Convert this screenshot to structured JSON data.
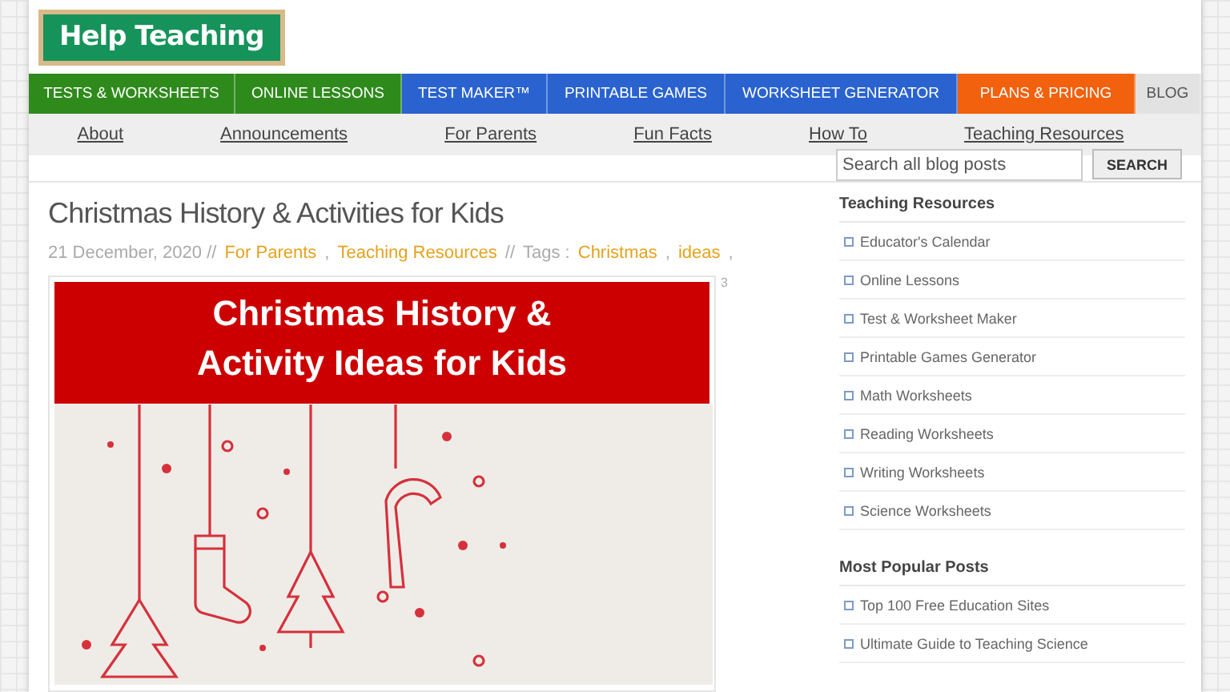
{
  "logo": {
    "text": "Help Teaching"
  },
  "nav": [
    {
      "label": "TESTS & WORKSHEETS",
      "color": "#2f8a1c",
      "selected": false
    },
    {
      "label": "ONLINE LESSONS",
      "color": "#2f8a1c",
      "selected": false
    },
    {
      "label": "TEST MAKER™",
      "color": "#2a63cf",
      "selected": false
    },
    {
      "label": "PRINTABLE GAMES",
      "color": "#2a63cf",
      "selected": false
    },
    {
      "label": "WORKSHEET GENERATOR",
      "color": "#2a63cf",
      "selected": false
    },
    {
      "label": "PLANS & PRICING",
      "color": "#f2610d",
      "selected": false
    },
    {
      "label": "BLOG",
      "color": "#e2e2e2",
      "selected": true
    }
  ],
  "subnav": [
    "About",
    "Announcements",
    "For Parents",
    "Fun Facts",
    "How To",
    "Teaching Resources"
  ],
  "search": {
    "placeholder": "Search all blog posts",
    "button": "SEARCH"
  },
  "post": {
    "title": "Christmas History & Activities for Kids",
    "date": "21 December, 2020 //",
    "categories": [
      "For Parents",
      "Teaching Resources"
    ],
    "list_separator": ",",
    "tags_separator": "//",
    "tags_label": "Tags :",
    "tags": [
      "Christmas",
      "ideas"
    ],
    "image": {
      "banner": "Christmas History & Activity Ideas for Kids",
      "corner_mark": "3"
    }
  },
  "sidebar": [
    {
      "heading": "Teaching Resources",
      "items": [
        "Educator's Calendar",
        "Online Lessons",
        "Test & Worksheet Maker",
        "Printable Games Generator",
        "Math Worksheets",
        "Reading Worksheets",
        "Writing Worksheets",
        "Science Worksheets"
      ]
    },
    {
      "heading": "Most Popular Posts",
      "items": [
        "Top 100 Free Education Sites",
        "Ultimate Guide to Teaching Science"
      ]
    }
  ]
}
